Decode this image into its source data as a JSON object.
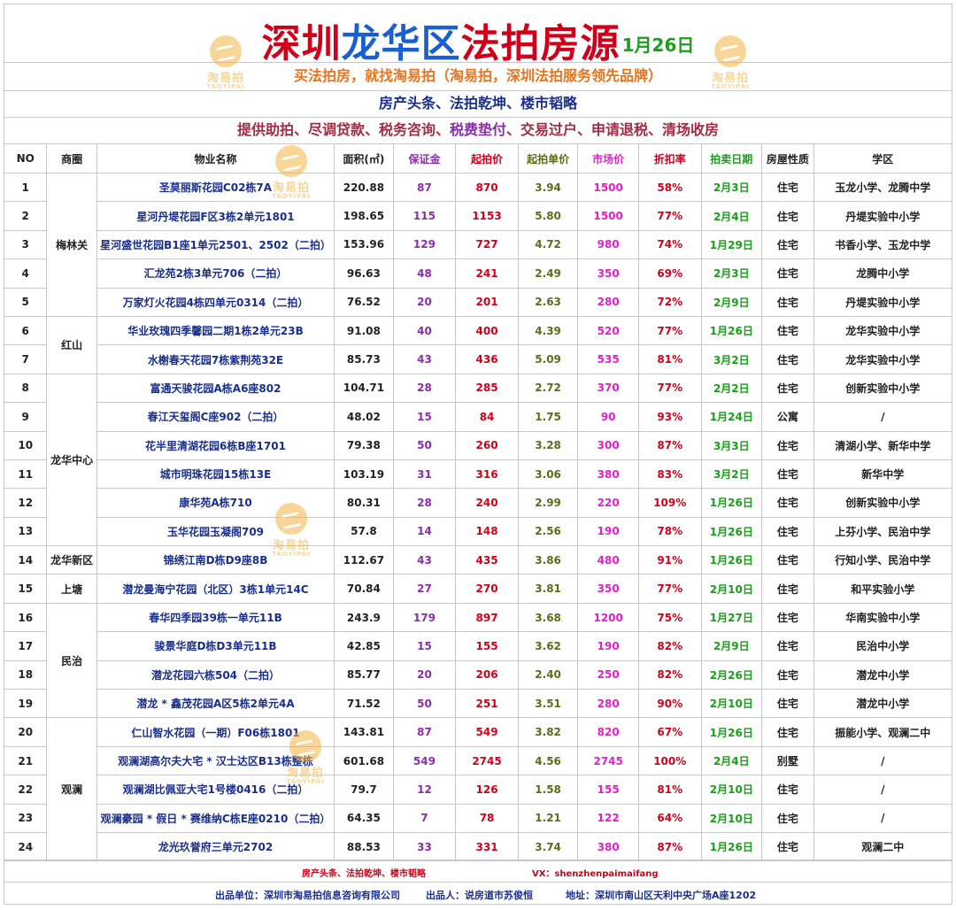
{
  "header": {
    "title_parts": [
      {
        "text": "深圳",
        "color": "#d0001a"
      },
      {
        "text": "龙华区",
        "color": "#1a5fd0"
      },
      {
        "text": "法拍房源",
        "color": "#d0001a"
      }
    ],
    "date": "1月26日",
    "slogan": "买法拍房，就找淘易拍（淘易拍，深圳法拍服务领先品牌）",
    "news": "房产头条、法拍乾坤、楼市韬略",
    "services": {
      "before": "提供助拍、尽调贷款、税务咨询、",
      "highlight": "税费垫付",
      "after": "、交易过户、申请退税、清场收房"
    }
  },
  "watermark": {
    "cn": "淘易拍",
    "en": "TAOYIPAI",
    "icon": "taoyipai-logo-icon"
  },
  "table": {
    "columns": [
      "NO",
      "商圈",
      "物业名称",
      "面积(㎡)",
      "保证金",
      "起拍价",
      "起拍单价",
      "市场价",
      "折扣率",
      "拍卖日期",
      "房屋性质",
      "学区"
    ],
    "districts": [
      {
        "name": "梅林关",
        "rows": 5
      },
      {
        "name": "红山",
        "rows": 2
      },
      {
        "name": "龙华中心",
        "rows": 6
      },
      {
        "name": "龙华新区",
        "rows": 1
      },
      {
        "name": "上塘",
        "rows": 1
      },
      {
        "name": "民治",
        "rows": 4
      },
      {
        "name": "观澜",
        "rows": 5
      }
    ],
    "rows": [
      {
        "no": "1",
        "name": "圣莫丽斯花园C02栋7A",
        "area": "220.88",
        "deposit": "87",
        "start": "870",
        "unit": "3.94",
        "market": "1500",
        "discount": "58%",
        "date": "2月3日",
        "type": "住宅",
        "school": "玉龙小学、龙腾中学"
      },
      {
        "no": "2",
        "name": "星河丹堤花园F区3栋2单元1801",
        "area": "198.65",
        "deposit": "115",
        "start": "1153",
        "unit": "5.80",
        "market": "1500",
        "discount": "77%",
        "date": "2月4日",
        "type": "住宅",
        "school": "丹堤实验中小学"
      },
      {
        "no": "3",
        "name": "星河盛世花园B1座1单元2501、2502（二拍）",
        "area": "153.96",
        "deposit": "129",
        "start": "727",
        "unit": "4.72",
        "market": "980",
        "discount": "74%",
        "date": "1月29日",
        "type": "住宅",
        "school": "书香小学、玉龙中学"
      },
      {
        "no": "4",
        "name": "汇龙苑2栋3单元706（二拍）",
        "area": "96.63",
        "deposit": "48",
        "start": "241",
        "unit": "2.49",
        "market": "350",
        "discount": "69%",
        "date": "2月3日",
        "type": "住宅",
        "school": "龙腾中小学"
      },
      {
        "no": "5",
        "name": "万家灯火花园4栋四单元0314（二拍）",
        "area": "76.52",
        "deposit": "20",
        "start": "201",
        "unit": "2.63",
        "market": "280",
        "discount": "72%",
        "date": "2月9日",
        "type": "住宅",
        "school": "丹堤实验中小学"
      },
      {
        "no": "6",
        "name": "华业玫瑰四季馨园二期1栋2单元23B",
        "area": "91.08",
        "deposit": "40",
        "start": "400",
        "unit": "4.39",
        "market": "520",
        "discount": "77%",
        "date": "1月26日",
        "type": "住宅",
        "school": "龙华实验中小学"
      },
      {
        "no": "7",
        "name": "水榭春天花园7栋紫荆苑32E",
        "area": "85.73",
        "deposit": "43",
        "start": "436",
        "unit": "5.09",
        "market": "535",
        "discount": "81%",
        "date": "3月2日",
        "type": "住宅",
        "school": "龙华实验中小学"
      },
      {
        "no": "8",
        "name": "富通天骏花园A栋A6座802",
        "area": "104.71",
        "deposit": "28",
        "start": "285",
        "unit": "2.72",
        "market": "370",
        "discount": "77%",
        "date": "2月2日",
        "type": "住宅",
        "school": "创新实验中小学"
      },
      {
        "no": "9",
        "name": "春江天玺阁C座902（二拍）",
        "area": "48.02",
        "deposit": "15",
        "start": "84",
        "unit": "1.75",
        "market": "90",
        "discount": "93%",
        "date": "1月24日",
        "type": "公寓",
        "school": "/"
      },
      {
        "no": "10",
        "name": "花半里清湖花园6栋B座1701",
        "area": "79.38",
        "deposit": "50",
        "start": "260",
        "unit": "3.28",
        "market": "300",
        "discount": "87%",
        "date": "3月3日",
        "type": "住宅",
        "school": "清湖小学、新华中学"
      },
      {
        "no": "11",
        "name": "城市明珠花园15栋13E",
        "area": "103.19",
        "deposit": "31",
        "start": "316",
        "unit": "3.06",
        "market": "380",
        "discount": "83%",
        "date": "3月2日",
        "type": "住宅",
        "school": "新华中学"
      },
      {
        "no": "12",
        "name": "康华苑A栋710",
        "area": "80.31",
        "deposit": "28",
        "start": "240",
        "unit": "2.99",
        "market": "220",
        "discount": "109%",
        "date": "1月26日",
        "type": "住宅",
        "school": "创新实验中小学"
      },
      {
        "no": "13",
        "name": "玉华花园玉凝阁709",
        "area": "57.8",
        "deposit": "14",
        "start": "148",
        "unit": "2.56",
        "market": "190",
        "discount": "78%",
        "date": "1月26日",
        "type": "住宅",
        "school": "上芬小学、民治中学"
      },
      {
        "no": "14",
        "name": "锦绣江南D栋D9座8B",
        "area": "112.67",
        "deposit": "43",
        "start": "435",
        "unit": "3.86",
        "market": "480",
        "discount": "91%",
        "date": "1月26日",
        "type": "住宅",
        "school": "行知小学、民治中学"
      },
      {
        "no": "15",
        "name": "潜龙曼海宁花园（北区）3栋1单元14C",
        "area": "70.84",
        "deposit": "27",
        "start": "270",
        "unit": "3.81",
        "market": "350",
        "discount": "77%",
        "date": "2月10日",
        "type": "住宅",
        "school": "和平实验小学"
      },
      {
        "no": "16",
        "name": "春华四季园39栋一单元11B",
        "area": "243.9",
        "deposit": "179",
        "start": "897",
        "unit": "3.68",
        "market": "1200",
        "discount": "75%",
        "date": "1月27日",
        "type": "住宅",
        "school": "华南实验中小学"
      },
      {
        "no": "17",
        "name": "骏景华庭D栋D3单元11B",
        "area": "42.85",
        "deposit": "15",
        "start": "155",
        "unit": "3.62",
        "market": "190",
        "discount": "82%",
        "date": "2月9日",
        "type": "住宅",
        "school": "民治中小学"
      },
      {
        "no": "18",
        "name": "潜龙花园六栋504（二拍）",
        "area": "85.77",
        "deposit": "20",
        "start": "206",
        "unit": "2.40",
        "market": "250",
        "discount": "82%",
        "date": "2月26日",
        "type": "住宅",
        "school": "潜龙中小学"
      },
      {
        "no": "19",
        "name": "潜龙 * 鑫茂花园A区5栋2单元4A",
        "area": "71.52",
        "deposit": "50",
        "start": "251",
        "unit": "3.51",
        "market": "280",
        "discount": "90%",
        "date": "2月10日",
        "type": "住宅",
        "school": "潜龙中小学"
      },
      {
        "no": "20",
        "name": "仁山智水花园（一期）F06栋1801",
        "area": "143.81",
        "deposit": "87",
        "start": "549",
        "unit": "3.82",
        "market": "820",
        "discount": "67%",
        "date": "1月26日",
        "type": "住宅",
        "school": "振能小学、观澜二中"
      },
      {
        "no": "21",
        "name": "观澜湖高尔夫大宅 * 汉士达区B13栋整栋",
        "area": "601.68",
        "deposit": "549",
        "start": "2745",
        "unit": "4.56",
        "market": "2745",
        "discount": "100%",
        "date": "2月4日",
        "type": "别墅",
        "school": "/"
      },
      {
        "no": "22",
        "name": "观澜湖比佩亚大宅1号楼0416（二拍）",
        "area": "79.7",
        "deposit": "12",
        "start": "126",
        "unit": "1.58",
        "market": "155",
        "discount": "81%",
        "date": "2月10日",
        "type": "住宅",
        "school": "/"
      },
      {
        "no": "23",
        "name": "观澜豪园 * 假日 * 赛维纳C栋E座0210（二拍）",
        "area": "64.35",
        "deposit": "7",
        "start": "78",
        "unit": "1.21",
        "market": "122",
        "discount": "64%",
        "date": "2月10日",
        "type": "住宅",
        "school": "/"
      },
      {
        "no": "24",
        "name": "龙光玖誉府三单元2702",
        "area": "88.53",
        "deposit": "33",
        "start": "331",
        "unit": "3.74",
        "market": "380",
        "discount": "87%",
        "date": "1月26日",
        "type": "住宅",
        "school": "观澜二中"
      }
    ]
  },
  "footer": {
    "line1_left": "房产头条、法拍乾坤、楼市韬略",
    "line1_right": "VX：shenzhenpaimaifang",
    "producer_unit": "出品单位：深圳市淘易拍信息咨询有限公司",
    "producer": "出品人：说房道市苏俊恒",
    "address": "地址：深圳市南山区天利中央广场A座1202"
  }
}
